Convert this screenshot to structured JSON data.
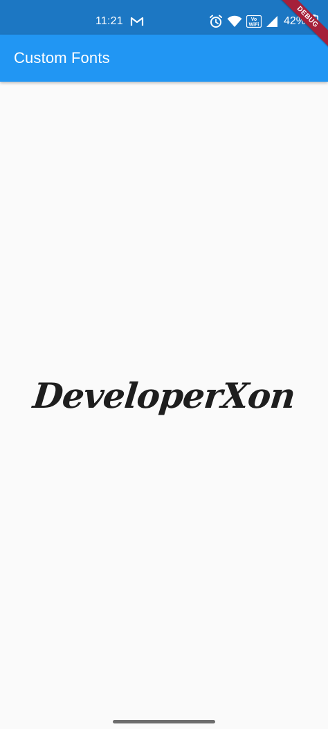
{
  "status_bar": {
    "time": "11:21",
    "battery_percent": "42%",
    "icons": [
      "gmail-icon",
      "alarm-icon",
      "wifi-icon",
      "vowifi-icon",
      "signal-icon",
      "battery-icon"
    ],
    "background": "#1c77c3",
    "vowifi_top": "Vo",
    "vowifi_bottom": "WiFi"
  },
  "app_bar": {
    "title": "Custom Fonts",
    "background": "#2196f3"
  },
  "main": {
    "text": "DeveloperXon",
    "text_color": "#1e1e1e"
  },
  "debug_banner": {
    "label": "DEBUG",
    "color": "#a5203a"
  },
  "page": {
    "background": "#fafafa"
  }
}
